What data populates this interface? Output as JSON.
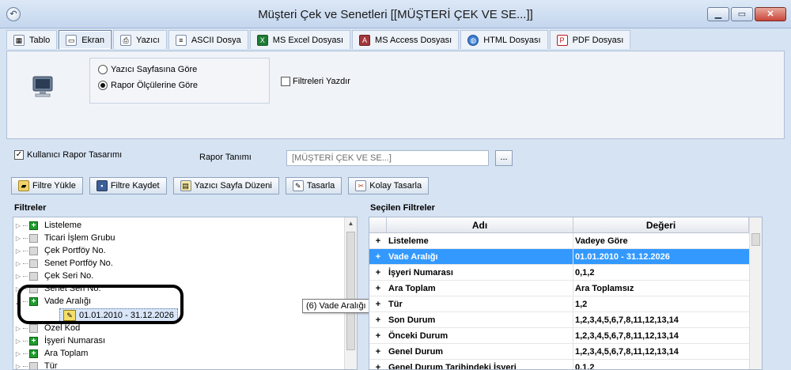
{
  "window": {
    "title": "Müşteri Çek ve Senetleri [[MÜŞTERİ ÇEK VE SE...]]",
    "controls": [
      "minimize",
      "maximize",
      "close"
    ]
  },
  "tabs": [
    {
      "label": "Tablo",
      "icon": "table-icon",
      "active": false
    },
    {
      "label": "Ekran",
      "icon": "monitor-icon",
      "active": true
    },
    {
      "label": "Yazıcı",
      "icon": "printer-icon",
      "active": false
    },
    {
      "label": "ASCII Dosya",
      "icon": "text-file-icon",
      "active": false
    },
    {
      "label": "MS Excel Dosyası",
      "icon": "excel-icon",
      "active": false
    },
    {
      "label": "MS Access Dosyası",
      "icon": "access-icon",
      "active": false
    },
    {
      "label": "HTML Dosyası",
      "icon": "globe-icon",
      "active": false
    },
    {
      "label": "PDF Dosyası",
      "icon": "pdf-icon",
      "active": false
    }
  ],
  "options": {
    "radio_1": "Yazıcı Sayfasına Göre",
    "radio_2": "Rapor Ölçülerine Göre",
    "selected": "radio_2",
    "filtreleri_yazdir": "Filtreleri Yazdır",
    "filtreleri_yazdir_checked": false
  },
  "design": {
    "kullanici_rapor_tasarimi": "Kullanıcı Rapor Tasarımı",
    "checked": true,
    "rapor_tanimi_label": "Rapor Tanımı",
    "rapor_tanimi_value": "[MÜŞTERİ ÇEK VE SE...]",
    "browse_label": "..."
  },
  "actions": [
    {
      "label": "Filtre Yükle",
      "icon": "folder-open-icon"
    },
    {
      "label": "Filtre Kaydet",
      "icon": "save-icon"
    },
    {
      "label": "Yazıcı Sayfa Düzeni",
      "icon": "page-setup-icon"
    },
    {
      "label": "Tasarla",
      "icon": "design-icon"
    },
    {
      "label": "Kolay Tasarla",
      "icon": "easy-design-icon"
    }
  ],
  "filters": {
    "title": "Filtreler",
    "items": [
      {
        "label": "Listeleme",
        "active": true
      },
      {
        "label": "Ticari İşlem Grubu",
        "active": false
      },
      {
        "label": "Çek Portföy No.",
        "active": false
      },
      {
        "label": "Senet Portföy No.",
        "active": false
      },
      {
        "label": "Çek Seri No.",
        "active": false
      },
      {
        "label": "Senet Seri No.",
        "active": false
      },
      {
        "label": "Vade Aralığı",
        "active": true,
        "expanded": true
      },
      {
        "label": "Özel Kod",
        "active": false
      },
      {
        "label": "İşyeri  Numarası",
        "active": true
      },
      {
        "label": "Ara Toplam",
        "active": true
      },
      {
        "label": "Tür",
        "active": false
      }
    ],
    "selected_node": "01.01.2010 - 31.12.2026",
    "tooltip": "(6) Vade Aralığı"
  },
  "selected_filters": {
    "title": "Seçilen Filtreler",
    "col_name": "Adı",
    "col_value": "Değeri",
    "rows": [
      {
        "name": "Listeleme",
        "value": "Vadeye Göre",
        "selected": false
      },
      {
        "name": "Vade Aralığı",
        "value": "01.01.2010 - 31.12.2026",
        "selected": true
      },
      {
        "name": "İşyeri  Numarası",
        "value": "0,1,2",
        "selected": false
      },
      {
        "name": "Ara Toplam",
        "value": "Ara Toplamsız",
        "selected": false
      },
      {
        "name": "Tür",
        "value": "1,2",
        "selected": false
      },
      {
        "name": "Son Durum",
        "value": "1,2,3,4,5,6,7,8,11,12,13,14",
        "selected": false
      },
      {
        "name": "Önceki Durum",
        "value": "1,2,3,4,5,6,7,8,11,12,13,14",
        "selected": false
      },
      {
        "name": "Genel Durum",
        "value": "1,2,3,4,5,6,7,8,11,12,13,14",
        "selected": false
      },
      {
        "name": "Genel Durum Tarihindeki İşyeri",
        "value": "0,1,2",
        "selected": false
      }
    ]
  }
}
